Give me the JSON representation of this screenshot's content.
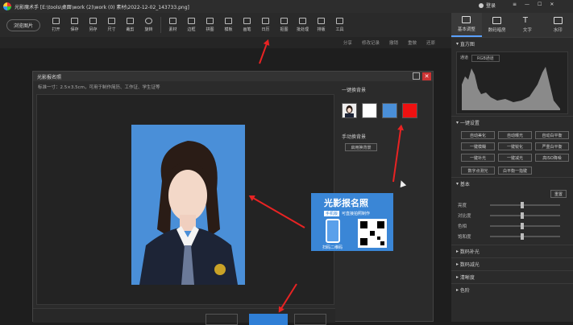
{
  "titlebar": {
    "app_title": "光影魔术手 [E:\\tools\\桌面\\work (2)\\work (0) 素材\\2022-12-02_143733.png]",
    "login": "登录"
  },
  "toolbar": {
    "browse": "浏览图片",
    "tools": [
      "打开",
      "保存",
      "另存",
      "尺寸",
      "裁剪",
      "旋转",
      "素材",
      "边框",
      "拼图",
      "模板",
      "画笔",
      "日历",
      "抠图",
      "批处理",
      "排版",
      "工具"
    ]
  },
  "subbar": {
    "share": "分享",
    "history": "修改记录",
    "undo": "撤销",
    "redo": "重做",
    "reset": "还原"
  },
  "rpanel": {
    "tabs": [
      "基本调整",
      "数码暗房",
      "文字",
      "水印"
    ],
    "histogram": "直方图",
    "channel_label": "通道",
    "channel_value": "RGB通道",
    "oneclick": "一键设置",
    "buttons": [
      "自动美化",
      "自动曝光",
      "自动白平衡",
      "一键模糊",
      "一键锐化",
      "严重白平衡",
      "一键补光",
      "一键减光",
      "高ISO降噪",
      "数字点测光",
      "白平衡一指键"
    ],
    "basic": "基本",
    "reset_btn": "重置",
    "sliders": [
      "亮度",
      "对比度",
      "色相",
      "饱和度"
    ],
    "sections": [
      "数码补光",
      "数码减光",
      "清晰度",
      "色阶"
    ]
  },
  "dialog": {
    "title": "光影报名照",
    "info": "标准一寸：2.5×3.5cm，可用于制作简历、工作证、学生证等",
    "change_bg": "一键换背景",
    "manual_bg": "手动换背景",
    "manual_bg_btn": "启用换背景",
    "ad_title": "光影报名照",
    "ad_badge": "手机版",
    "ad_sub": "可直接拍照制作",
    "ad_scan": "扫码二维码"
  },
  "colors": {
    "bg_white": "#ffffff",
    "bg_blue": "#4a8fd8",
    "bg_red": "#ee1111"
  }
}
